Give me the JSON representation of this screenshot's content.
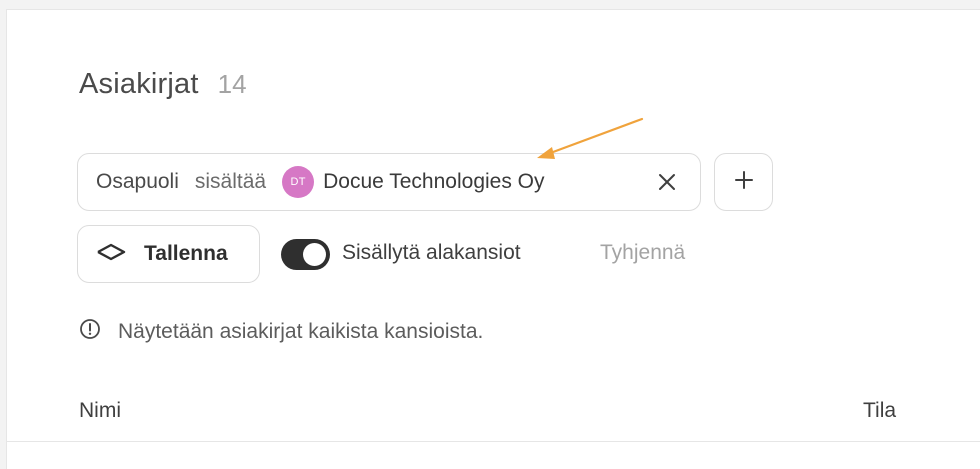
{
  "page": {
    "title": "Asiakirjat",
    "count": "14"
  },
  "filter": {
    "field": "Osapuoli",
    "operator": "sisältää",
    "avatar_initials": "DT",
    "value": "Docue Technologies Oy",
    "avatar_color": "#d678c5",
    "close_icon": "close-icon",
    "add_icon": "plus-icon"
  },
  "actions": {
    "save_label": "Tallenna",
    "save_icon": "diamond-outline-icon",
    "toggle_label": "Sisällytä alakansiot",
    "toggle_on": true,
    "clear_label": "Tyhjennä"
  },
  "info": {
    "icon": "info-circle-icon",
    "text": "Näytetään asiakirjat kaikista kansioista."
  },
  "table": {
    "columns": [
      "Nimi",
      "Tila"
    ]
  },
  "annotation": {
    "arrow_color": "#f0a33c"
  }
}
